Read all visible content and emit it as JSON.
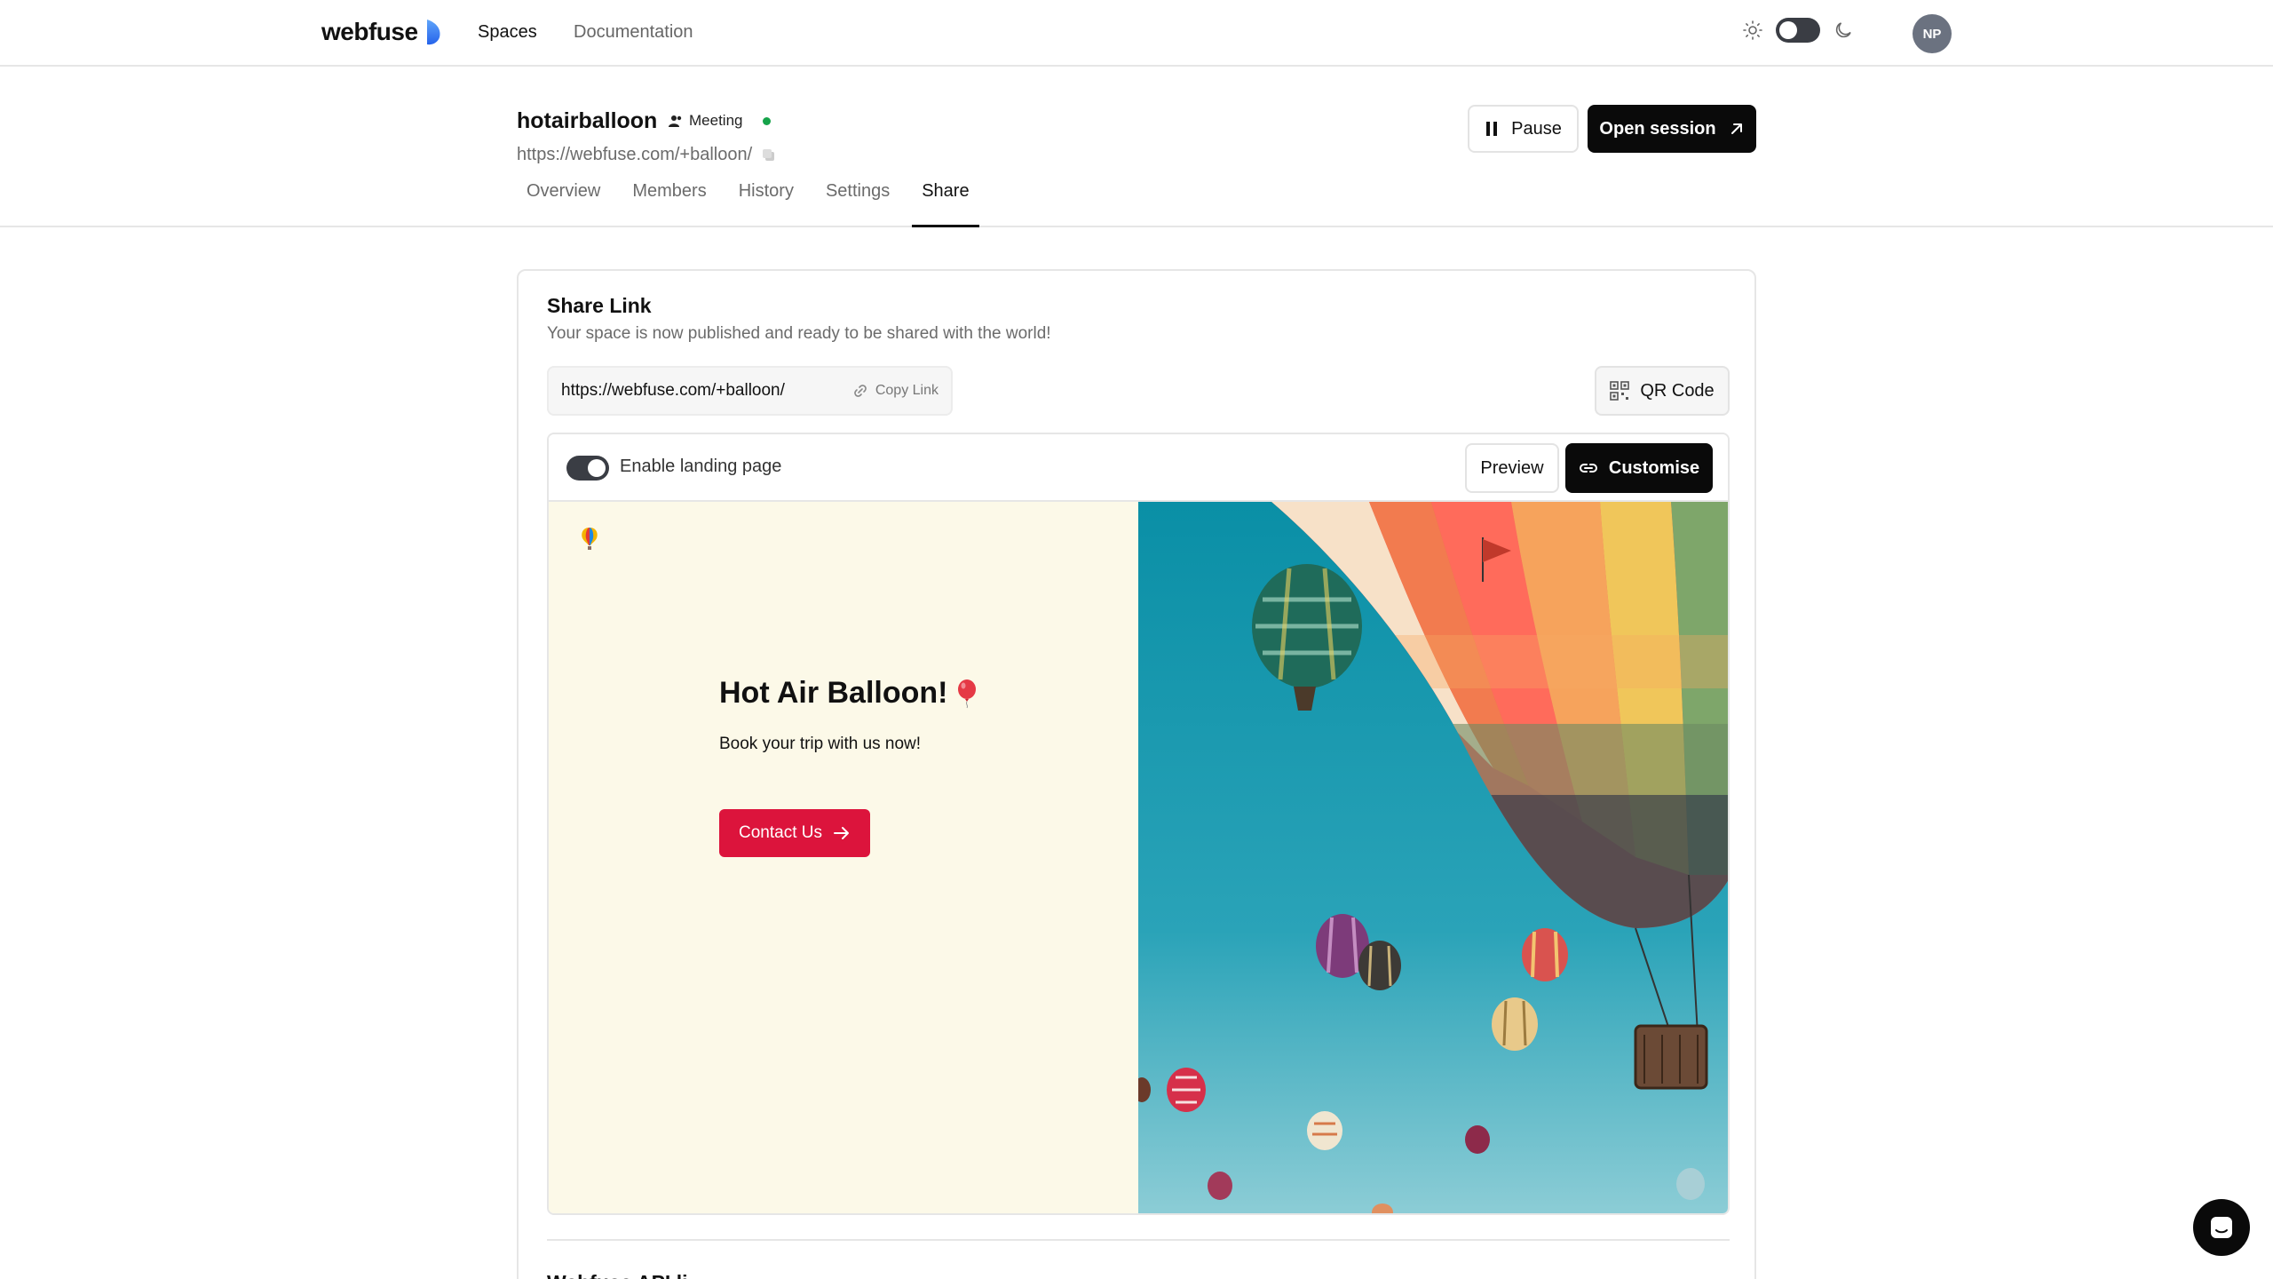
{
  "topbar": {
    "logo_text": "webfuse",
    "nav": [
      {
        "label": "Spaces",
        "active": true
      },
      {
        "label": "Documentation",
        "active": false
      }
    ],
    "avatar_initials": "NP",
    "icons": [
      "sun-icon",
      "moon-icon"
    ]
  },
  "space": {
    "name": "hotairballoon",
    "type_badge": "Meeting",
    "url": "https://webfuse.com/+balloon/",
    "status_color": "#16a34a",
    "pause_label": "Pause",
    "open_label": "Open session",
    "tabs": [
      {
        "label": "Overview",
        "active": false
      },
      {
        "label": "Members",
        "active": false
      },
      {
        "label": "History",
        "active": false
      },
      {
        "label": "Settings",
        "active": false
      },
      {
        "label": "Share",
        "active": true
      }
    ]
  },
  "share": {
    "title": "Share Link",
    "subtitle": "Your space is now published and ready to be shared with the world!",
    "link_value": "https://webfuse.com/+balloon/",
    "copy_label": "Copy Link",
    "qr_label": "QR Code",
    "landing_toggle_label": "Enable landing page",
    "landing_enabled": true,
    "preview_label": "Preview",
    "customise_label": "Customise"
  },
  "landing_preview": {
    "heading": "Hot Air Balloon!",
    "subheading": "Book your trip with us now!",
    "cta_label": "Contact Us",
    "accent_color": "#dc143c",
    "background_color": "#fcf9e8"
  },
  "next_section": {
    "title": "Webfuse API li"
  }
}
